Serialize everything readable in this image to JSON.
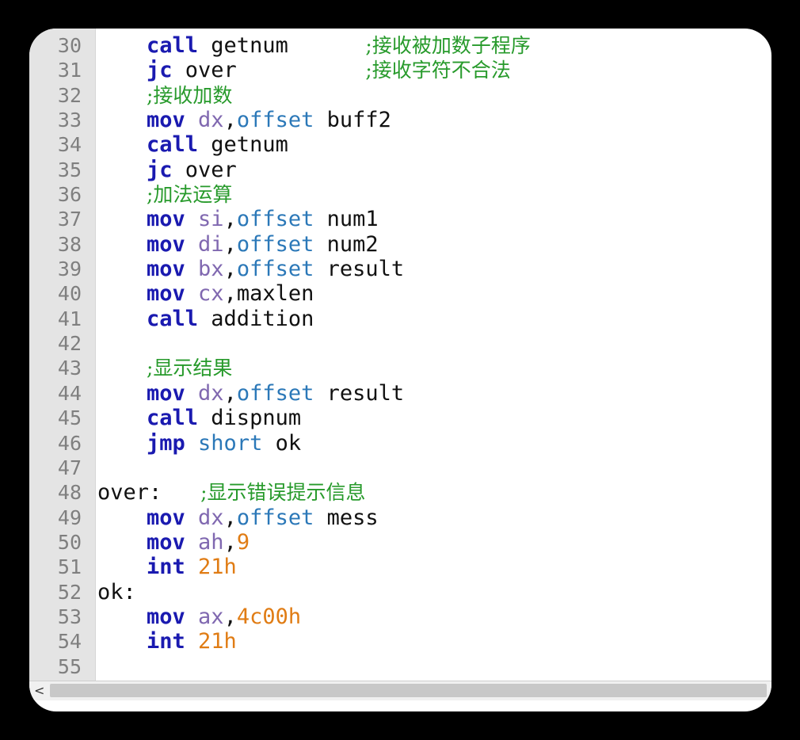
{
  "editor": {
    "lines": [
      {
        "n": "30",
        "indent": true,
        "tokens": [
          {
            "t": "kw",
            "v": "call"
          },
          {
            "t": "sp",
            "v": " "
          },
          {
            "t": "txt",
            "v": "getnum"
          },
          {
            "t": "sp",
            "v": "      "
          },
          {
            "t": "cmt",
            "v": ";接收被加数子程序"
          }
        ]
      },
      {
        "n": "31",
        "indent": true,
        "tokens": [
          {
            "t": "kw",
            "v": "jc"
          },
          {
            "t": "sp",
            "v": " "
          },
          {
            "t": "txt",
            "v": "over"
          },
          {
            "t": "sp",
            "v": "          "
          },
          {
            "t": "cmt",
            "v": ";接收字符不合法"
          }
        ]
      },
      {
        "n": "32",
        "indent": true,
        "tokens": [
          {
            "t": "cmt",
            "v": ";接收加数"
          }
        ]
      },
      {
        "n": "33",
        "indent": true,
        "tokens": [
          {
            "t": "kw",
            "v": "mov"
          },
          {
            "t": "sp",
            "v": " "
          },
          {
            "t": "reg",
            "v": "dx"
          },
          {
            "t": "txt",
            "v": ","
          },
          {
            "t": "dir",
            "v": "offset"
          },
          {
            "t": "sp",
            "v": " "
          },
          {
            "t": "txt",
            "v": "buff2"
          }
        ]
      },
      {
        "n": "34",
        "indent": true,
        "tokens": [
          {
            "t": "kw",
            "v": "call"
          },
          {
            "t": "sp",
            "v": " "
          },
          {
            "t": "txt",
            "v": "getnum"
          }
        ]
      },
      {
        "n": "35",
        "indent": true,
        "tokens": [
          {
            "t": "kw",
            "v": "jc"
          },
          {
            "t": "sp",
            "v": " "
          },
          {
            "t": "txt",
            "v": "over"
          }
        ]
      },
      {
        "n": "36",
        "indent": true,
        "tokens": [
          {
            "t": "cmt",
            "v": ";加法运算"
          }
        ]
      },
      {
        "n": "37",
        "indent": true,
        "tokens": [
          {
            "t": "kw",
            "v": "mov"
          },
          {
            "t": "sp",
            "v": " "
          },
          {
            "t": "reg",
            "v": "si"
          },
          {
            "t": "txt",
            "v": ","
          },
          {
            "t": "dir",
            "v": "offset"
          },
          {
            "t": "sp",
            "v": " "
          },
          {
            "t": "txt",
            "v": "num1"
          }
        ]
      },
      {
        "n": "38",
        "indent": true,
        "tokens": [
          {
            "t": "kw",
            "v": "mov"
          },
          {
            "t": "sp",
            "v": " "
          },
          {
            "t": "reg",
            "v": "di"
          },
          {
            "t": "txt",
            "v": ","
          },
          {
            "t": "dir",
            "v": "offset"
          },
          {
            "t": "sp",
            "v": " "
          },
          {
            "t": "txt",
            "v": "num2"
          }
        ]
      },
      {
        "n": "39",
        "indent": true,
        "tokens": [
          {
            "t": "kw",
            "v": "mov"
          },
          {
            "t": "sp",
            "v": " "
          },
          {
            "t": "reg",
            "v": "bx"
          },
          {
            "t": "txt",
            "v": ","
          },
          {
            "t": "dir",
            "v": "offset"
          },
          {
            "t": "sp",
            "v": " "
          },
          {
            "t": "txt",
            "v": "result"
          }
        ]
      },
      {
        "n": "40",
        "indent": true,
        "tokens": [
          {
            "t": "kw",
            "v": "mov"
          },
          {
            "t": "sp",
            "v": " "
          },
          {
            "t": "reg",
            "v": "cx"
          },
          {
            "t": "txt",
            "v": ",maxlen"
          }
        ]
      },
      {
        "n": "41",
        "indent": true,
        "tokens": [
          {
            "t": "kw",
            "v": "call"
          },
          {
            "t": "sp",
            "v": " "
          },
          {
            "t": "txt",
            "v": "addition"
          }
        ]
      },
      {
        "n": "42",
        "indent": false,
        "tokens": []
      },
      {
        "n": "43",
        "indent": true,
        "tokens": [
          {
            "t": "cmt",
            "v": ";显示结果"
          }
        ]
      },
      {
        "n": "44",
        "indent": true,
        "tokens": [
          {
            "t": "kw",
            "v": "mov"
          },
          {
            "t": "sp",
            "v": " "
          },
          {
            "t": "reg",
            "v": "dx"
          },
          {
            "t": "txt",
            "v": ","
          },
          {
            "t": "dir",
            "v": "offset"
          },
          {
            "t": "sp",
            "v": " "
          },
          {
            "t": "txt",
            "v": "result"
          }
        ]
      },
      {
        "n": "45",
        "indent": true,
        "tokens": [
          {
            "t": "kw",
            "v": "call"
          },
          {
            "t": "sp",
            "v": " "
          },
          {
            "t": "txt",
            "v": "dispnum"
          }
        ]
      },
      {
        "n": "46",
        "indent": true,
        "tokens": [
          {
            "t": "kw",
            "v": "jmp"
          },
          {
            "t": "sp",
            "v": " "
          },
          {
            "t": "dir",
            "v": "short"
          },
          {
            "t": "sp",
            "v": " "
          },
          {
            "t": "txt",
            "v": "ok"
          }
        ]
      },
      {
        "n": "47",
        "indent": false,
        "tokens": []
      },
      {
        "n": "48",
        "indent": false,
        "tokens": [
          {
            "t": "lbl",
            "v": "over:"
          },
          {
            "t": "sp",
            "v": "   "
          },
          {
            "t": "cmt",
            "v": ";显示错误提示信息"
          }
        ]
      },
      {
        "n": "49",
        "indent": true,
        "tokens": [
          {
            "t": "kw",
            "v": "mov"
          },
          {
            "t": "sp",
            "v": " "
          },
          {
            "t": "reg",
            "v": "dx"
          },
          {
            "t": "txt",
            "v": ","
          },
          {
            "t": "dir",
            "v": "offset"
          },
          {
            "t": "sp",
            "v": " "
          },
          {
            "t": "txt",
            "v": "mess"
          }
        ]
      },
      {
        "n": "50",
        "indent": true,
        "tokens": [
          {
            "t": "kw",
            "v": "mov"
          },
          {
            "t": "sp",
            "v": " "
          },
          {
            "t": "reg",
            "v": "ah"
          },
          {
            "t": "txt",
            "v": ","
          },
          {
            "t": "num",
            "v": "9"
          }
        ]
      },
      {
        "n": "51",
        "indent": true,
        "tokens": [
          {
            "t": "kw",
            "v": "int"
          },
          {
            "t": "sp",
            "v": " "
          },
          {
            "t": "num",
            "v": "21h"
          }
        ]
      },
      {
        "n": "52",
        "indent": false,
        "tokens": [
          {
            "t": "lbl",
            "v": "ok:"
          }
        ]
      },
      {
        "n": "53",
        "indent": true,
        "tokens": [
          {
            "t": "kw",
            "v": "mov"
          },
          {
            "t": "sp",
            "v": " "
          },
          {
            "t": "reg",
            "v": "ax"
          },
          {
            "t": "txt",
            "v": ","
          },
          {
            "t": "num",
            "v": "4c00h"
          }
        ]
      },
      {
        "n": "54",
        "indent": true,
        "tokens": [
          {
            "t": "kw",
            "v": "int"
          },
          {
            "t": "sp",
            "v": " "
          },
          {
            "t": "num",
            "v": "21h"
          }
        ]
      },
      {
        "n": "55",
        "indent": false,
        "tokens": []
      }
    ]
  },
  "scrollbar": {
    "left_arrow": "<"
  },
  "colors": {
    "keyword": "#1a1ab0",
    "register": "#8068b0",
    "directive": "#2b78b8",
    "number": "#e07c14",
    "comment": "#279a2b",
    "gutter_bg": "#e4e4e4"
  }
}
